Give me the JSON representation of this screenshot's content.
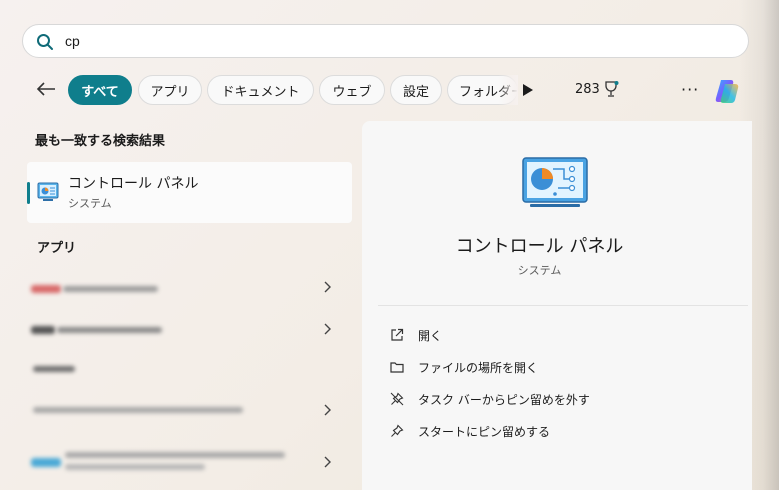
{
  "search": {
    "query": "cp"
  },
  "filters": {
    "tabs": [
      {
        "label": "すべて"
      },
      {
        "label": "アプリ"
      },
      {
        "label": "ドキュメント"
      },
      {
        "label": "ウェブ"
      },
      {
        "label": "設定"
      },
      {
        "label": "フォルダー"
      }
    ],
    "points": "283"
  },
  "best_match": {
    "heading": "最も一致する検索結果",
    "title": "コントロール パネル",
    "subtitle": "システム"
  },
  "apps": {
    "heading": "アプリ"
  },
  "detail": {
    "title": "コントロール パネル",
    "subtitle": "システム",
    "actions": [
      {
        "label": "開く",
        "icon": "open-external-icon"
      },
      {
        "label": "ファイルの場所を開く",
        "icon": "folder-icon"
      },
      {
        "label": "タスク バーからピン留めを外す",
        "icon": "unpin-icon"
      },
      {
        "label": "スタートにピン留めする",
        "icon": "pin-icon"
      }
    ]
  },
  "colors": {
    "accent": "#0f7e8c"
  }
}
